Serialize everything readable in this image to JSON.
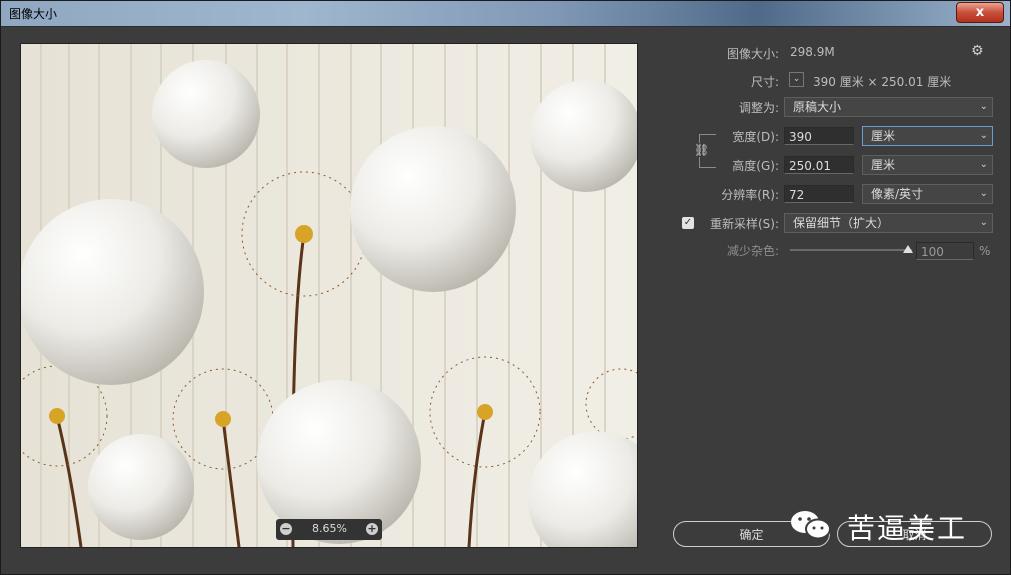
{
  "window": {
    "title": "图像大小",
    "close_label": "x"
  },
  "image_size": {
    "label": "图像大小:",
    "value": "298.9M"
  },
  "dimensions": {
    "label": "尺寸:",
    "value": "390 厘米 × 250.01 厘米"
  },
  "fit_to": {
    "label": "调整为:",
    "value": "原稿大小"
  },
  "width": {
    "label": "宽度(D):",
    "value": "390",
    "unit": "厘米"
  },
  "height": {
    "label": "高度(G):",
    "value": "250.01",
    "unit": "厘米"
  },
  "resolution": {
    "label": "分辨率(R):",
    "value": "72",
    "unit": "像素/英寸"
  },
  "resample": {
    "label": "重新采样(S):",
    "value": "保留细节（扩大）",
    "checked": true
  },
  "noise": {
    "label": "减少杂色:",
    "value": "100",
    "unit": "%",
    "level": 1.0
  },
  "zoom": {
    "value": "8.65%"
  },
  "buttons": {
    "ok": "确定",
    "cancel": "取消"
  },
  "watermark": {
    "text": "苦逼美工"
  },
  "icons": {
    "settings": "gear-icon",
    "link": "chain-link-icon",
    "dimensions_dropdown": "chevron-down-icon",
    "zoom_out": "minus-icon",
    "zoom_in": "plus-icon",
    "watermark": "wechat-icon"
  },
  "colors": {
    "dialog_bg": "#3c3c3c",
    "accent_border": "#6c9bd0"
  }
}
